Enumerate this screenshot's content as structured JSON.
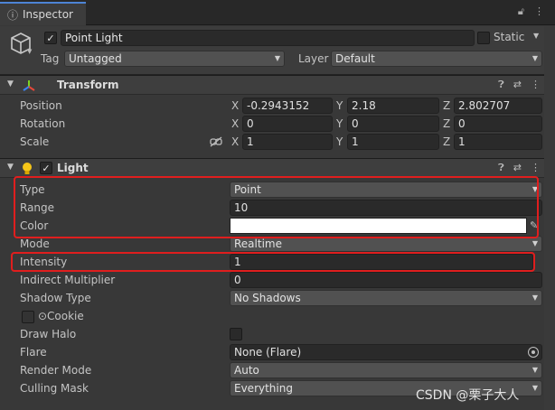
{
  "tab": {
    "title": "Inspector",
    "icon": "info-icon"
  },
  "header": {
    "object_name": "Point Light",
    "static_label": "Static",
    "tag_label": "Tag",
    "tag_value": "Untagged",
    "layer_label": "Layer",
    "layer_value": "Default"
  },
  "transform": {
    "title": "Transform",
    "position_label": "Position",
    "rotation_label": "Rotation",
    "scale_label": "Scale",
    "position": {
      "x": "-0.2943152",
      "y": "2.18",
      "z": "2.802707"
    },
    "rotation": {
      "x": "0",
      "y": "0",
      "z": "0"
    },
    "scale": {
      "x": "1",
      "y": "1",
      "z": "1"
    },
    "axis_x": "X",
    "axis_y": "Y",
    "axis_z": "Z"
  },
  "light": {
    "title": "Light",
    "type_label": "Type",
    "type_value": "Point",
    "range_label": "Range",
    "range_value": "10",
    "color_label": "Color",
    "color_value": "#ffffff",
    "mode_label": "Mode",
    "mode_value": "Realtime",
    "intensity_label": "Intensity",
    "intensity_value": "1",
    "indirect_label": "Indirect Multiplier",
    "indirect_value": "0",
    "shadow_label": "Shadow Type",
    "shadow_value": "No Shadows",
    "cookie_label": "Cookie",
    "halo_label": "Draw Halo",
    "flare_label": "Flare",
    "flare_value": "None (Flare)",
    "render_mode_label": "Render Mode",
    "render_mode_value": "Auto",
    "culling_label": "Culling Mask",
    "culling_value": "Everything"
  },
  "watermark": "CSDN @栗子大人",
  "colors": {
    "highlight": "#e01e1e",
    "tab_accent": "#4d84d6"
  }
}
